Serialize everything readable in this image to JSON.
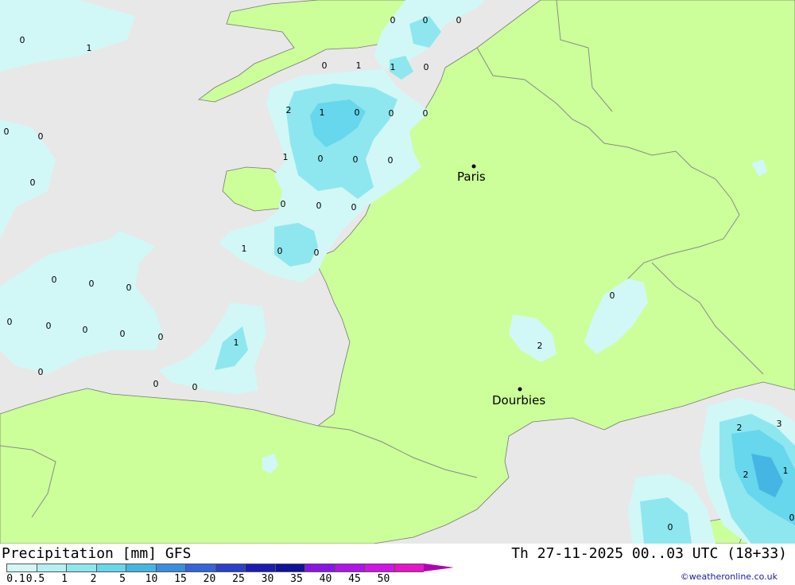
{
  "map": {
    "colors": {
      "sea": "#e8e8e8",
      "land": "#ccff99",
      "border": "#8a8a8a",
      "p01": "#d2f7f7",
      "p1": "#8ee7ee",
      "p2": "#66d7ec",
      "p3": "#45b6e3"
    },
    "cities": [
      {
        "name": "Paris"
      },
      {
        "name": "Dourbies"
      }
    ],
    "labels": [
      "0",
      "1",
      "0",
      "0",
      "0",
      "0",
      "1",
      "1",
      "0",
      "2",
      "1",
      "0",
      "0",
      "0",
      "0",
      "0",
      "0",
      "1",
      "0",
      "0",
      "0",
      "0",
      "0",
      "0",
      "1",
      "0",
      "0",
      "0",
      "0",
      "0",
      "0",
      "0",
      "0",
      "0",
      "1",
      "0",
      "0",
      "0",
      "0",
      "2",
      "0",
      "2",
      "3",
      "2",
      "1",
      "0",
      "0"
    ]
  },
  "footer": {
    "title": "Precipitation [mm] GFS",
    "datetime": "Th 27-11-2025 00..03 UTC (18+33)",
    "credit": "©weatheronline.co.uk",
    "scale_labels": [
      "0.1",
      "0.5",
      "1",
      "2",
      "5",
      "10",
      "15",
      "20",
      "25",
      "30",
      "35",
      "40",
      "45",
      "50"
    ],
    "scale_colors": [
      "#d2f7f7",
      "#b4f0f3",
      "#8ee7ee",
      "#66d7ec",
      "#45b6e3",
      "#3a8ee0",
      "#3564d8",
      "#2a40c8",
      "#1c1cb4",
      "#11119a",
      "#8a14e6",
      "#b014e6",
      "#d214e6",
      "#e614c8"
    ],
    "scale_end_color": "#b000b0"
  }
}
